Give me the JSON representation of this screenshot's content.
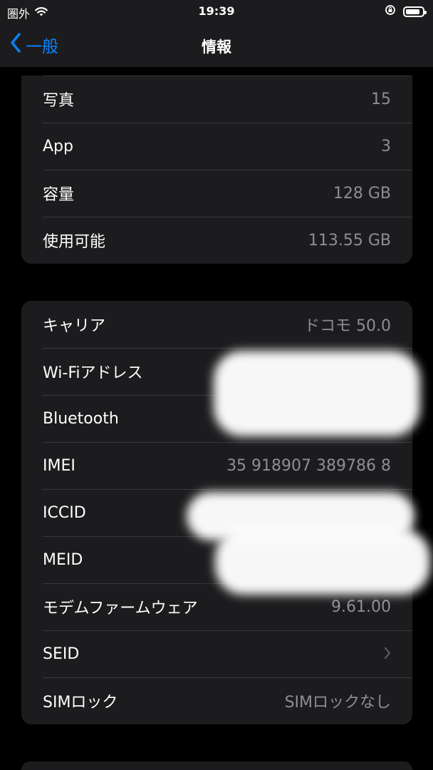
{
  "status_bar": {
    "carrier": "圏外",
    "time": "19:39",
    "battery_level": 0.85
  },
  "nav": {
    "back_label": "一般",
    "title": "情報"
  },
  "group1": [
    {
      "label": "写真",
      "value": "15"
    },
    {
      "label": "App",
      "value": "3"
    },
    {
      "label": "容量",
      "value": "128 GB"
    },
    {
      "label": "使用可能",
      "value": "113.55 GB"
    }
  ],
  "group2": [
    {
      "label": "キャリア",
      "value": "ドコモ 50.0"
    },
    {
      "label": "Wi-Fiアドレス",
      "value": ""
    },
    {
      "label": "Bluetooth",
      "value": ""
    },
    {
      "label": "IMEI",
      "value": "35 918907 389786 8"
    },
    {
      "label": "ICCID",
      "value": ""
    },
    {
      "label": "MEID",
      "value": ""
    },
    {
      "label": "モデムファームウェア",
      "value": "9.61.00"
    },
    {
      "label": "SEID",
      "value": ""
    },
    {
      "label": "SIMロック",
      "value": "SIMロックなし"
    }
  ],
  "icons": {
    "back": "chevron-left-icon",
    "wifi": "wifi-icon",
    "orientation_lock": "orientation-lock-icon",
    "battery": "battery-icon",
    "disclosure": "chevron-right-icon"
  }
}
